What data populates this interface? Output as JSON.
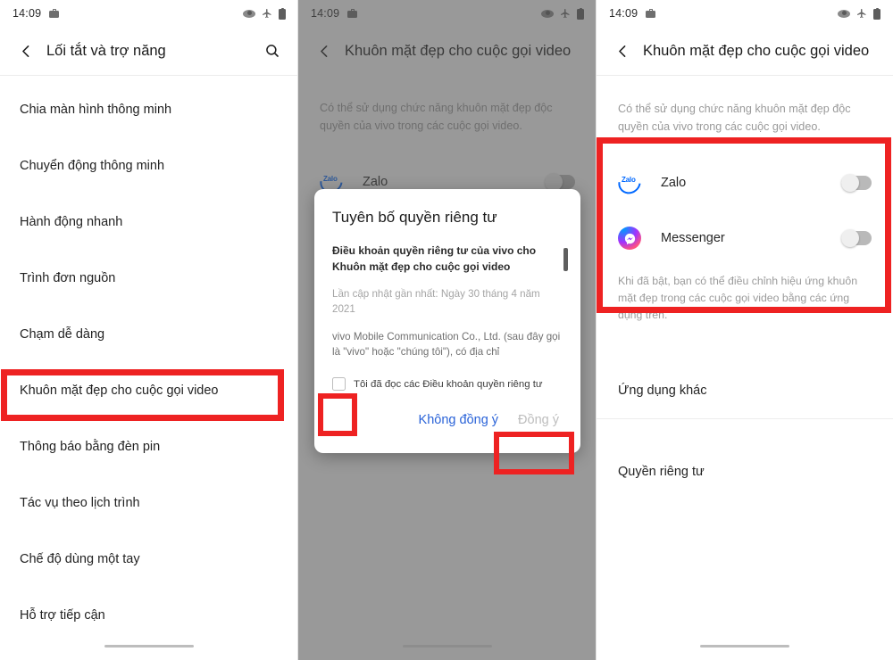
{
  "status_bar": {
    "time": "14:09",
    "icons": [
      "work-profile-icon",
      "data-saver-icon",
      "airplane-mode-icon",
      "battery-icon"
    ]
  },
  "colors": {
    "callout_red": "#ee2222",
    "link_blue": "#2a63d8",
    "zalo_blue": "#0068ff",
    "muted_text": "#9a9a9a"
  },
  "panel1": {
    "title": "Lối tắt và trợ năng",
    "search_label": "search-icon",
    "items": [
      {
        "label": "Chia màn hình thông minh"
      },
      {
        "label": "Chuyển động thông minh"
      },
      {
        "label": "Hành động nhanh"
      },
      {
        "label": "Trình đơn nguồn"
      },
      {
        "label": "Chạm dễ dàng"
      },
      {
        "label": "Khuôn mặt đẹp cho cuộc gọi video"
      },
      {
        "label": "Thông báo bằng đèn pin"
      },
      {
        "label": "Tác vụ theo lịch trình"
      },
      {
        "label": "Chế độ dùng một tay"
      },
      {
        "label": "Hỗ trợ tiếp cận"
      }
    ],
    "highlighted_item": "Khuôn mặt đẹp cho cuộc gọi video"
  },
  "panel2": {
    "title": "Khuôn mặt đẹp cho cuộc gọi video",
    "description": "Có thể sử dụng chức năng khuôn mặt đẹp độc quyền của vivo trong các cuộc gọi video.",
    "app_row": {
      "name": "Zalo",
      "icon": "zalo-icon",
      "toggle_state": "off"
    },
    "dialog": {
      "title": "Tuyên bố quyền riêng tư",
      "subtitle": "Điều khoản quyền riêng tư của vivo cho Khuôn mặt đẹp cho cuộc gọi video",
      "updated": "Lần cập nhật gần nhất: Ngày 30 tháng 4 năm 2021",
      "paragraph": "vivo Mobile Communication Co., Ltd. (sau đây gọi là \"vivo\" hoặc \"chúng tôi\"), có địa chỉ",
      "checkbox_label": "Tôi đã đọc các Điều khoản quyền riêng tư",
      "checkbox_checked": false,
      "decline_label": "Không đồng ý",
      "accept_label": "Đồng ý"
    }
  },
  "panel3": {
    "title": "Khuôn mặt đẹp cho cuộc gọi video",
    "description": "Có thể sử dụng chức năng khuôn mặt đẹp độc quyền của vivo trong các cuộc gọi video.",
    "apps": [
      {
        "name": "Zalo",
        "icon": "zalo-icon",
        "toggle_state": "off"
      },
      {
        "name": "Messenger",
        "icon": "messenger-icon",
        "toggle_state": "off"
      }
    ],
    "note": "Khi đã bật, bạn có thể điều chỉnh hiệu ứng khuôn mặt đẹp trong các cuộc gọi video bằng các ứng dụng trên.",
    "rows": [
      {
        "label": "Ứng dụng khác"
      },
      {
        "label": "Quyền riêng tư"
      }
    ]
  }
}
